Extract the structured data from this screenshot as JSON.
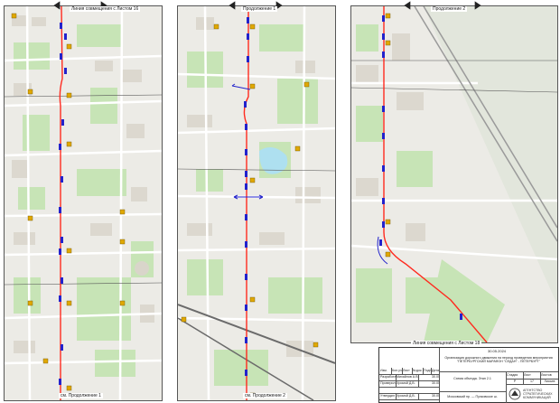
{
  "panels": [
    {
      "top_label": "Линия совмещения с Листом 16",
      "bottom_label": "см. Продолжение 1"
    },
    {
      "top_label": "Продолжение 1",
      "bottom_label": "см. Продолжение 2"
    },
    {
      "top_label": "Продолжение 2",
      "bottom_label": "Линия совмещения с Листом 18"
    }
  ],
  "title_block": {
    "date": "30.05.2024",
    "description": "Организация дорожного движения на период проведения мероприятия \"ПЕТЕРБУРГСКИЙ МАРАФОН \"СЕДАН\" - ПЕТЕРБУРГ\"",
    "roles": [
      "Разработал",
      "Проверил",
      "",
      "",
      "Н.контр.",
      "Утвердил"
    ],
    "names": [
      "Михайлов А.В.",
      "Хромой Д.В.",
      "",
      "",
      "Хромой Д.В.",
      "Хромой Д.В."
    ],
    "dates": [
      "30.05",
      "30.05",
      "",
      "",
      "30.05",
      "30.05"
    ],
    "header_cols": [
      "Изм.",
      "Кол.уч.",
      "Лист",
      "№док.",
      "Подп.",
      "Дата"
    ],
    "stage_headers": [
      "Стадия",
      "Лист",
      "Листов"
    ],
    "stage_values": [
      "Р",
      "17",
      "Лисьев"
    ],
    "sheet_title": "Схема объезда. Этап 2.1",
    "location": "Московский пр. — Пулковское ш.",
    "org": "АГЕНТСТВО СТРАТЕГИЧЕСКИХ КОММУНИКАЦИЙ"
  },
  "colors": {
    "route": "#ff2a1f",
    "marker": "#2222cc",
    "sign": "#e0a800",
    "map_bg": "#ecebe6",
    "park": "#c7e4b6",
    "water": "#aee0f0",
    "road": "#ffffff",
    "rail": "#6b6b6b"
  }
}
